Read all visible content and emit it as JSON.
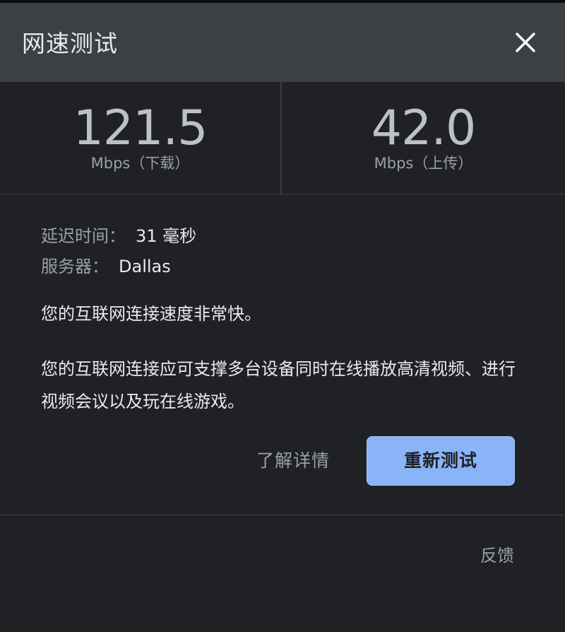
{
  "dialog": {
    "title": "网速测试",
    "close_icon": "close-icon"
  },
  "metrics": {
    "download": {
      "value": "121.5",
      "unit": "Mbps（下载）"
    },
    "upload": {
      "value": "42.0",
      "unit": "Mbps（上传）"
    }
  },
  "info": {
    "latency_label": "延迟时间：",
    "latency_value": "31 毫秒",
    "server_label": "服务器：",
    "server_value": "Dallas"
  },
  "summary": "您的互联网连接速度非常快。",
  "detail": "您的互联网连接应可支撑多台设备同时在线播放高清视频、进行视频会议以及玩在线游戏。",
  "actions": {
    "learn_more": "了解详情",
    "retest": "重新测试"
  },
  "footer": {
    "feedback": "反馈"
  },
  "colors": {
    "background": "#202124",
    "header": "#3c4043",
    "accent_button": "#8ab4f8"
  }
}
